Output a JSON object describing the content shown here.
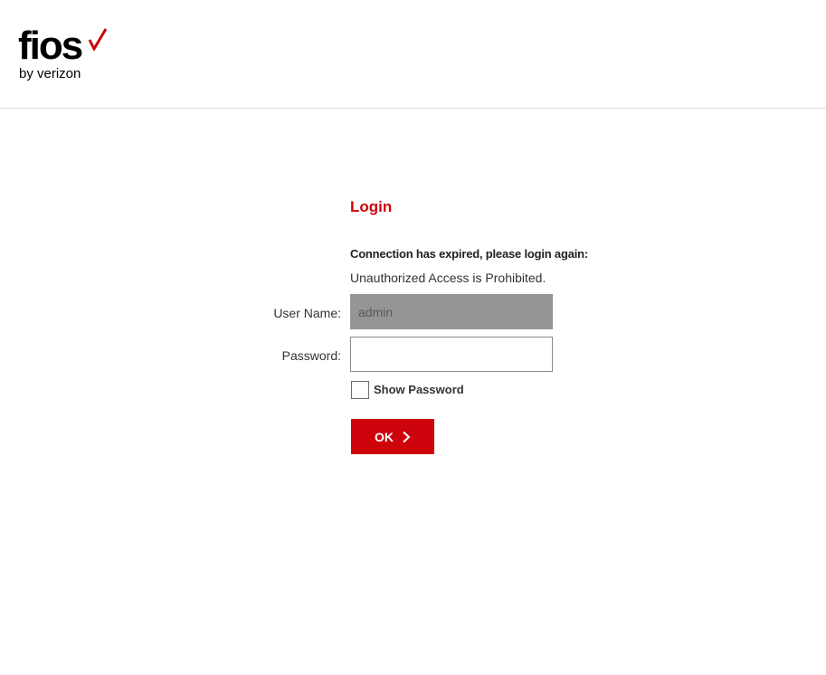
{
  "brand": {
    "logo_word": "fios",
    "logo_sub": "by verizon",
    "accent_color": "#cd040b"
  },
  "login": {
    "title": "Login",
    "expired_message": "Connection has expired, please login again:",
    "notice": "Unauthorized Access is Prohibited.",
    "username_label": "User Name:",
    "username_value": "admin",
    "password_label": "Password:",
    "password_value": "",
    "show_password_label": "Show Password",
    "show_password_checked": false,
    "ok_label": "OK",
    "ok_icon": "chevron-right-icon"
  }
}
